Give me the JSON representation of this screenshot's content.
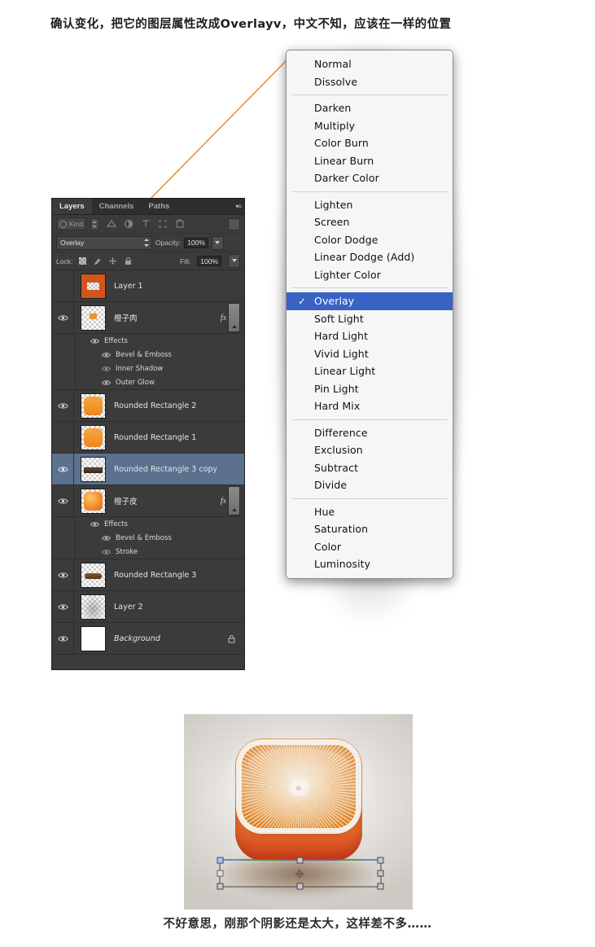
{
  "captions": {
    "top": "确认变化，把它的图层属性改成Overlayv，中文不知，应该在一样的位置",
    "bottom": "不好意思，刚那个阴影还是太大，这样差不多……"
  },
  "colors": {
    "panel_bg": "#3b3b3b",
    "panel_tab_bg": "#2e2e2e",
    "selected_layer": "#5b718e",
    "menu_bg": "#f6f6f6",
    "menu_highlight": "#3a61c4",
    "arrow_line": "#e8923a",
    "orange": "#ee8a32"
  },
  "layers_panel": {
    "tabs": [
      {
        "label": "Layers",
        "active": true
      },
      {
        "label": "Channels",
        "active": false
      },
      {
        "label": "Paths",
        "active": false
      }
    ],
    "panel_menu_icon": "panel-menu-icon",
    "filter_row": {
      "kind_label": "Kind",
      "icons": [
        "pixel-filter-icon",
        "adjustment-filter-icon",
        "type-filter-icon",
        "shape-filter-icon",
        "smart-object-filter-icon"
      ],
      "toggle_name": "filter-enable-toggle"
    },
    "blend_row": {
      "blend_mode": "Overlay",
      "opacity_label": "Opacity:",
      "opacity_value": "100%"
    },
    "lock_row": {
      "lock_label": "Lock:",
      "lock_icons": [
        "lock-transparent-pixels-icon",
        "lock-image-pixels-icon",
        "lock-position-icon",
        "lock-all-icon"
      ],
      "fill_label": "Fill:",
      "fill_value": "100%"
    },
    "layers": [
      {
        "name": "Layer 1",
        "visible": false,
        "selected": false,
        "thumb": "orange-solid",
        "has_fx": false,
        "effects": []
      },
      {
        "name": "橙子肉",
        "visible": true,
        "selected": false,
        "thumb": "orange-small",
        "has_fx": true,
        "fx_label": "fx",
        "effects_label": "Effects",
        "effects": [
          "Bevel & Emboss",
          "Inner Shadow",
          "Outer Glow"
        ]
      },
      {
        "name": "Rounded Rectangle 2",
        "visible": true,
        "selected": false,
        "thumb": "rounded-orange",
        "has_fx": false,
        "effects": []
      },
      {
        "name": "Rounded Rectangle 1",
        "visible": false,
        "selected": false,
        "thumb": "rounded-orange",
        "has_fx": false,
        "effects": []
      },
      {
        "name": "Rounded Rectangle 3 copy",
        "visible": true,
        "selected": true,
        "thumb": "thin-bar",
        "has_fx": false,
        "effects": []
      },
      {
        "name": "橙子皮",
        "visible": true,
        "selected": false,
        "thumb": "rounded-orange",
        "has_fx": true,
        "fx_label": "fx",
        "effects_label": "Effects",
        "effects": [
          "Bevel & Emboss",
          "Stroke"
        ]
      },
      {
        "name": "Rounded Rectangle 3",
        "visible": true,
        "selected": false,
        "thumb": "brown-bar",
        "has_fx": false,
        "effects": []
      },
      {
        "name": "Layer 2",
        "visible": true,
        "selected": false,
        "thumb": "gray-gradient",
        "has_fx": false,
        "effects": []
      },
      {
        "name": "Background",
        "visible": true,
        "selected": false,
        "thumb": "white",
        "has_fx": false,
        "locked": true,
        "effects": []
      }
    ]
  },
  "blend_menu": {
    "selected": "Overlay",
    "check_glyph": "✓",
    "groups": [
      [
        "Normal",
        "Dissolve"
      ],
      [
        "Darken",
        "Multiply",
        "Color Burn",
        "Linear Burn",
        "Darker Color"
      ],
      [
        "Lighten",
        "Screen",
        "Color Dodge",
        "Linear Dodge (Add)",
        "Lighter Color"
      ],
      [
        "Overlay",
        "Soft Light",
        "Hard Light",
        "Vivid Light",
        "Linear Light",
        "Pin Light",
        "Hard Mix"
      ],
      [
        "Difference",
        "Exclusion",
        "Subtract",
        "Divide"
      ],
      [
        "Hue",
        "Saturation",
        "Color",
        "Luminosity"
      ]
    ]
  },
  "figure": {
    "name": "orange-icon-preview",
    "alt": "Orange slice icon with free transform bounding box"
  }
}
